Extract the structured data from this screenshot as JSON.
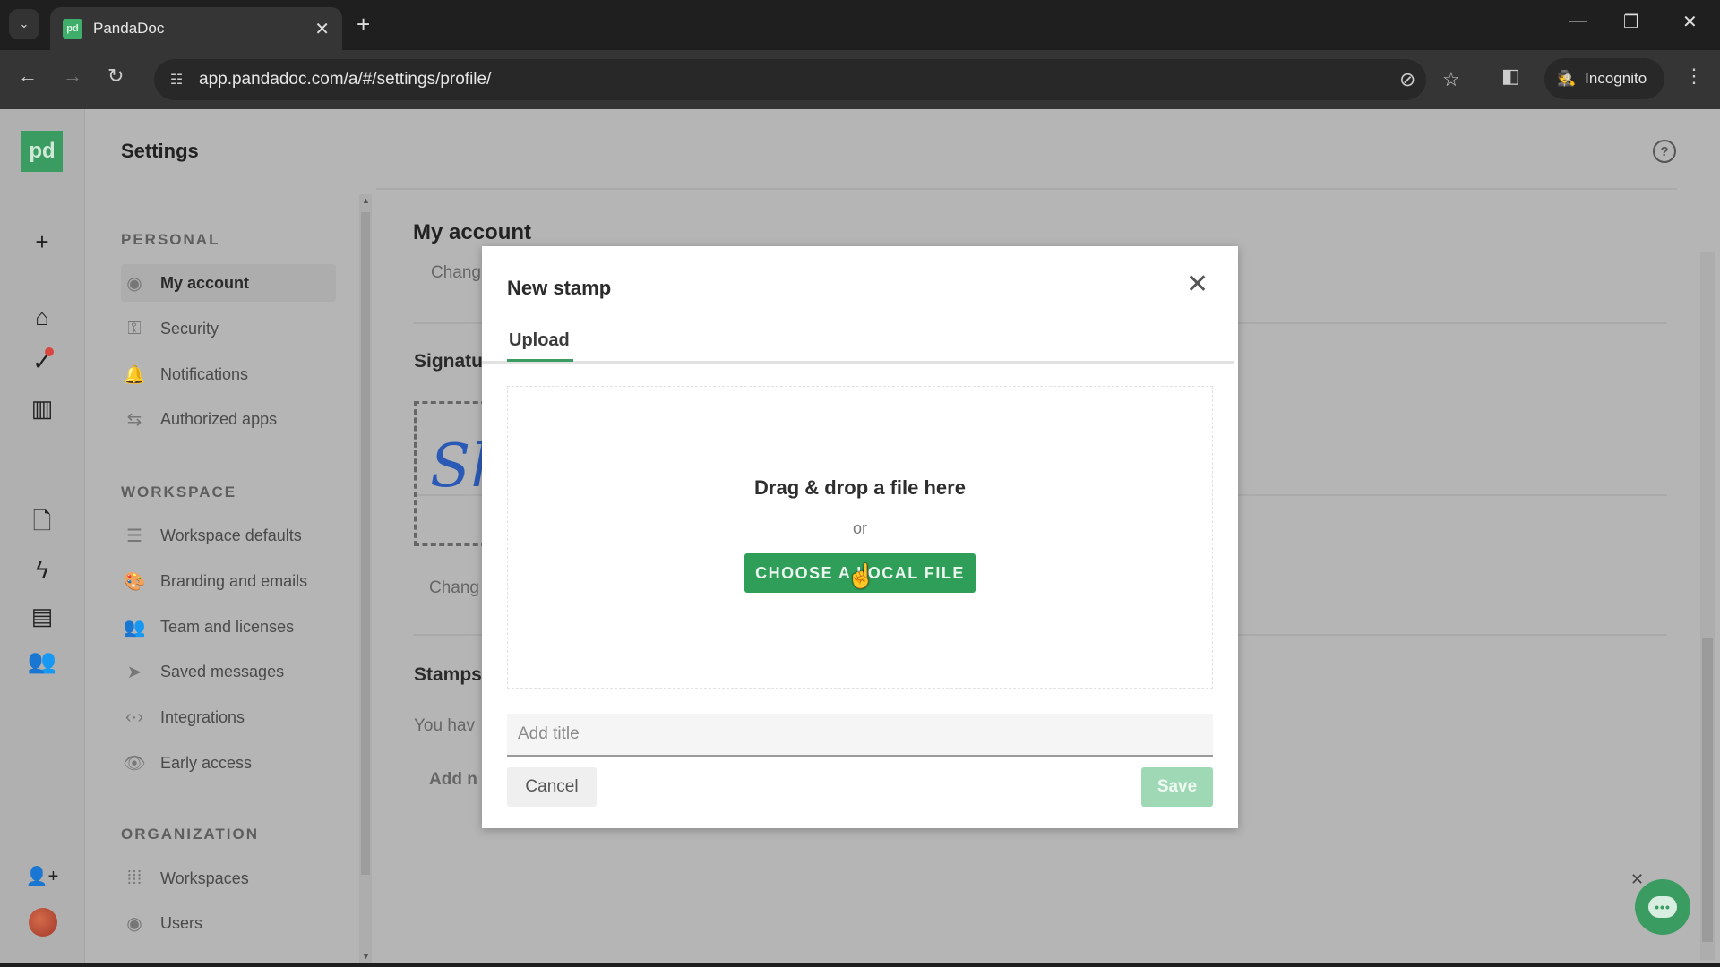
{
  "browser": {
    "tab_title": "PandaDoc",
    "favicon": "pd",
    "url": "app.pandadoc.com/a/#/settings/profile/",
    "incognito_label": "Incognito",
    "icons": {
      "tab_search": "⌄",
      "tab_close": "✕",
      "new_tab": "+",
      "minimize": "—",
      "restore": "❐",
      "close": "✕",
      "back": "←",
      "forward": "→",
      "reload": "↻",
      "site_info": "☷",
      "eye_off": "⊘",
      "star": "☆",
      "side_panel": "◧",
      "incognito": "🕵",
      "kebab": "⋮"
    }
  },
  "rail": {
    "logo": "pd",
    "icons": {
      "create": "+",
      "home": "⌂",
      "tasks": "✓",
      "reports": "▥",
      "documents": "🗋",
      "automation": "ϟ",
      "templates": "▤",
      "contacts": "👥",
      "invite": "👤+"
    }
  },
  "header": {
    "title": "Settings",
    "help_icon": "?"
  },
  "nav": {
    "sections": [
      {
        "label": "PERSONAL"
      },
      {
        "label": "WORKSPACE"
      },
      {
        "label": "ORGANIZATION"
      }
    ],
    "items": [
      {
        "label": "My account",
        "icon": "◉",
        "active": true
      },
      {
        "label": "Security",
        "icon": "⚿"
      },
      {
        "label": "Notifications",
        "icon": "🔔"
      },
      {
        "label": "Authorized apps",
        "icon": "⇆"
      },
      {
        "label": "Workspace defaults",
        "icon": "☰"
      },
      {
        "label": "Branding and emails",
        "icon": "🎨"
      },
      {
        "label": "Team and licenses",
        "icon": "👥"
      },
      {
        "label": "Saved messages",
        "icon": "➤"
      },
      {
        "label": "Integrations",
        "icon": "‹·›"
      },
      {
        "label": "Early access",
        "icon": "👁"
      },
      {
        "label": "Workspaces",
        "icon": "⁞⁞⁞"
      },
      {
        "label": "Users",
        "icon": "◉"
      }
    ]
  },
  "main": {
    "title": "My account",
    "change_label_top": "Chang",
    "signature_heading": "Signatu",
    "signature_sample": "Sh",
    "change_label_sig": "Chang",
    "stamps_heading": "Stamps",
    "stamps_text": "You hav",
    "add_new_label": "Add n"
  },
  "modal": {
    "title": "New stamp",
    "close_icon": "✕",
    "tabs": [
      {
        "label": "Upload",
        "active": true
      }
    ],
    "drop_heading": "Drag & drop a file here",
    "or_text": "or",
    "choose_button": "CHOOSE A LOCAL FILE",
    "title_placeholder": "Add title",
    "title_value": "",
    "cancel_label": "Cancel",
    "save_label": "Save"
  },
  "chat_widget": {
    "close_icon": "✕",
    "bubble": "•••"
  },
  "colors": {
    "brand_green": "#3a9c60",
    "primary_button": "#2f9e58",
    "save_disabled": "#9ed8b4",
    "notification_dot": "#d9463e",
    "signature_blue": "#2b5ab6"
  }
}
